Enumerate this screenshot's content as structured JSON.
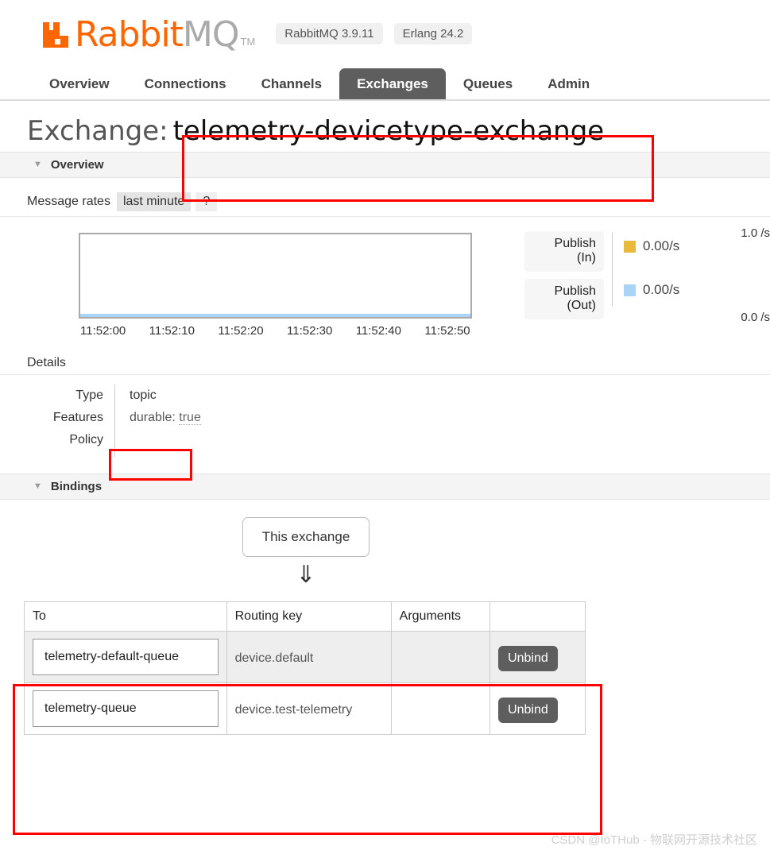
{
  "header": {
    "logo_name_orange": "Rabbit",
    "logo_name_gray": "MQ",
    "trademark": "TM",
    "badges": [
      "RabbitMQ 3.9.11",
      "Erlang 24.2"
    ]
  },
  "nav": {
    "tabs": [
      {
        "label": "Overview",
        "active": false
      },
      {
        "label": "Connections",
        "active": false
      },
      {
        "label": "Channels",
        "active": false
      },
      {
        "label": "Exchanges",
        "active": true
      },
      {
        "label": "Queues",
        "active": false
      },
      {
        "label": "Admin",
        "active": false
      }
    ]
  },
  "page": {
    "title_prefix": "Exchange:",
    "exchange_name": "telemetry-devicetype-exchange"
  },
  "overview": {
    "section_label": "Overview",
    "caret": "▼",
    "message_rates_label": "Message rates",
    "period_chip": "last minute",
    "help_chip": "?"
  },
  "chart_data": {
    "type": "line",
    "title": "Message rates",
    "xlabel": "",
    "ylabel": "/s",
    "ylim": [
      0.0,
      1.0
    ],
    "ytick_labels": [
      "1.0 /s",
      "0.0 /s"
    ],
    "x": [
      "11:52:00",
      "11:52:10",
      "11:52:20",
      "11:52:30",
      "11:52:40",
      "11:52:50"
    ],
    "grid": false,
    "legend_position": "right",
    "series": [
      {
        "name": "Publish (In)",
        "color": "#e8b93a",
        "rate": "0.00/s",
        "values": [
          0,
          0,
          0,
          0,
          0,
          0
        ]
      },
      {
        "name": "Publish (Out)",
        "color": "#aad4f5",
        "rate": "0.00/s",
        "values": [
          0,
          0,
          0,
          0,
          0,
          0
        ]
      }
    ]
  },
  "details": {
    "label": "Details",
    "rows": [
      {
        "key": "Type",
        "value": "topic",
        "value_dim": "",
        "empty": false
      },
      {
        "key": "Features",
        "value": "durable:",
        "value_dim": "true",
        "empty": false
      },
      {
        "key": "Policy",
        "value": "",
        "value_dim": "",
        "empty": true
      }
    ]
  },
  "bindings": {
    "section_label": "Bindings",
    "caret": "▼",
    "this_exchange_label": "This exchange",
    "arrow": "⇓",
    "columns": [
      "To",
      "Routing key",
      "Arguments",
      ""
    ],
    "rows": [
      {
        "to": "telemetry-default-queue",
        "routing_key": "device.default",
        "arguments": "",
        "action": "Unbind"
      },
      {
        "to": "telemetry-queue",
        "routing_key": "device.test-telemetry",
        "arguments": "",
        "action": "Unbind"
      }
    ]
  },
  "watermark": "CSDN @IoTHub - 物联网开源技术社区"
}
